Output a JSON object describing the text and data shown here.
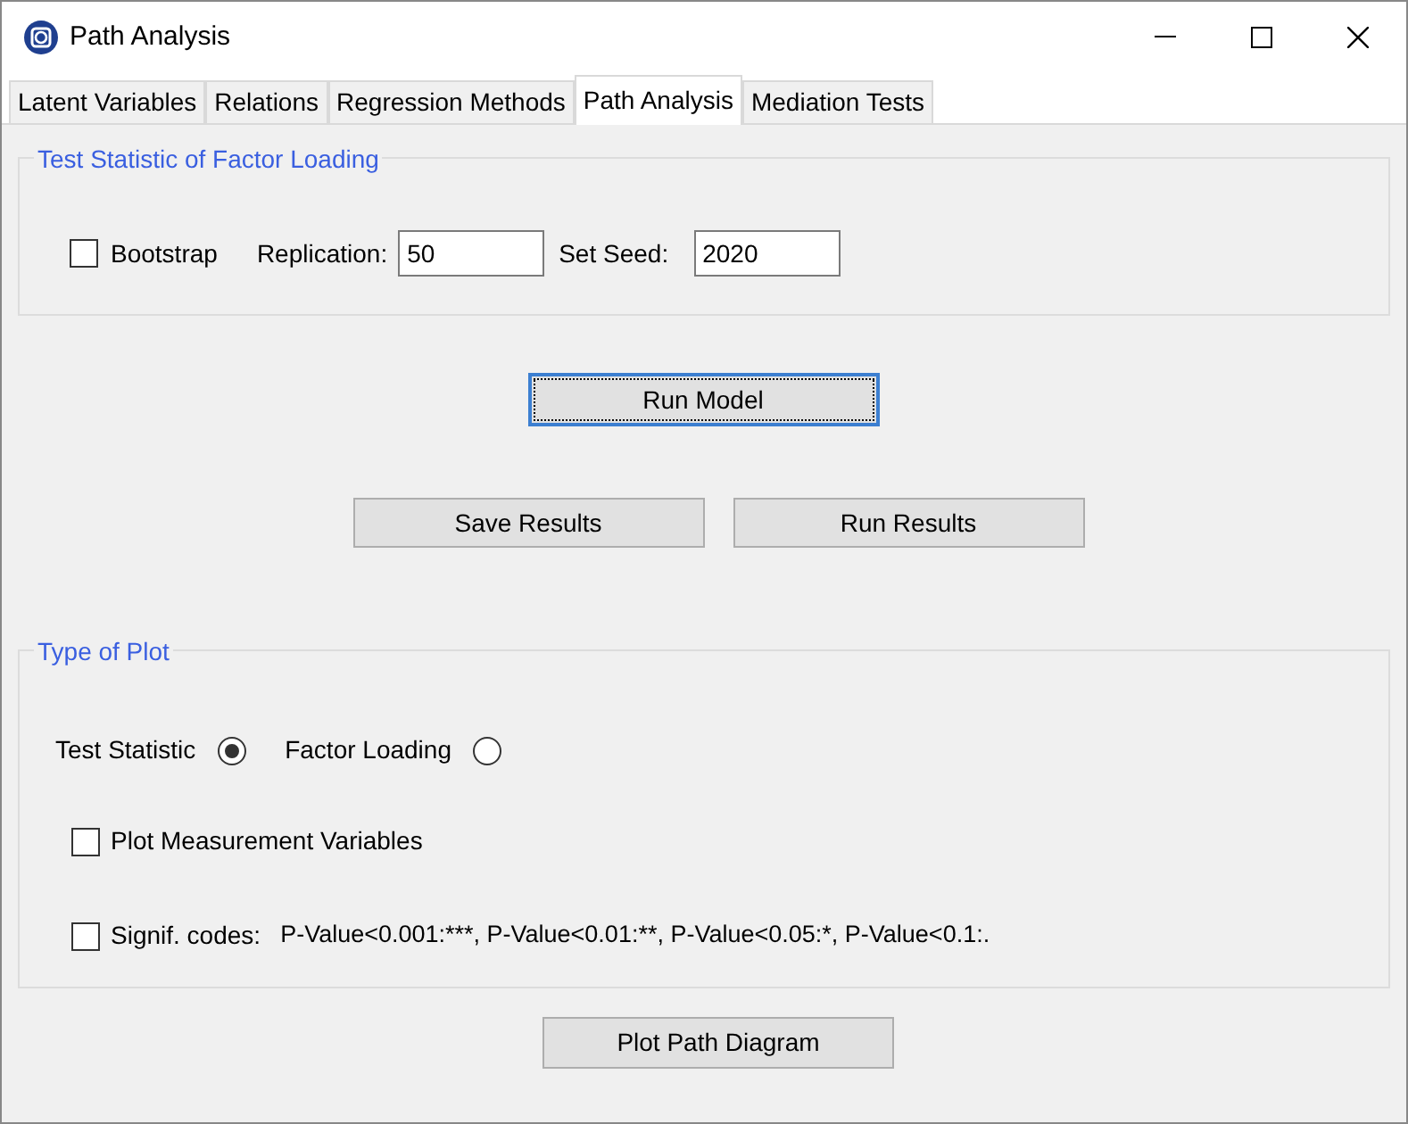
{
  "window": {
    "title": "Path Analysis"
  },
  "tabs": [
    {
      "label": "Latent Variables",
      "selected": false
    },
    {
      "label": "Relations",
      "selected": false
    },
    {
      "label": "Regression Methods",
      "selected": false
    },
    {
      "label": "Path Analysis",
      "selected": true
    },
    {
      "label": "Mediation Tests",
      "selected": false
    }
  ],
  "test_statistic_group": {
    "title": "Test Statistic of Factor Loading",
    "bootstrap": {
      "label": "Bootstrap",
      "checked": false
    },
    "replication": {
      "label": "Replication:",
      "value": "50"
    },
    "seed": {
      "label": "Set Seed:",
      "value": "2020"
    }
  },
  "run_model_button": "Run Model",
  "save_results_button": "Save Results",
  "run_results_button": "Run Results",
  "plot_group": {
    "title": "Type of Plot",
    "plot_types": [
      {
        "label": "Test Statistic",
        "selected": true
      },
      {
        "label": "Factor Loading",
        "selected": false
      }
    ],
    "measurement": {
      "label": "Plot Measurement Variables",
      "checked": false
    },
    "signif": {
      "label": "Signif. codes:",
      "checked": false,
      "codes": "P-Value<0.001:***, P-Value<0.01:**, P-Value<0.05:*, P-Value<0.1:."
    }
  },
  "plot_button": "Plot Path Diagram"
}
